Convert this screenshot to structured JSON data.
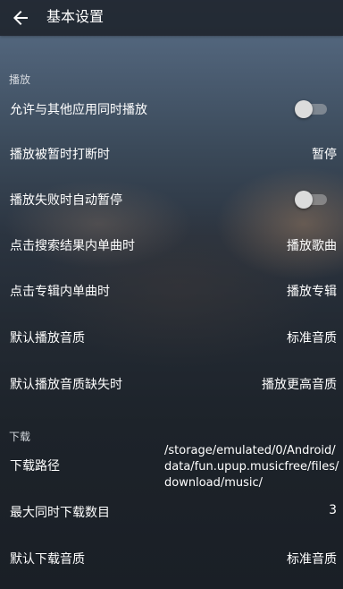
{
  "header": {
    "title": "基本设置"
  },
  "sections": {
    "playback": "播放",
    "download": "下载"
  },
  "playback": {
    "allow_other_apps": {
      "label": "允许与其他应用同时播放",
      "enabled": false
    },
    "on_interrupt": {
      "label": "播放被暂时打断时",
      "value": "暂停"
    },
    "auto_pause_on_fail": {
      "label": "播放失败时自动暂停",
      "enabled": false
    },
    "search_result_click": {
      "label": "点击搜索结果内单曲时",
      "value": "播放歌曲"
    },
    "album_click": {
      "label": "点击专辑内单曲时",
      "value": "播放专辑"
    },
    "default_quality": {
      "label": "默认播放音质",
      "value": "标准音质"
    },
    "quality_missing": {
      "label": "默认播放音质缺失时",
      "value": "播放更高音质"
    }
  },
  "download": {
    "path": {
      "label": "下载路径",
      "value_lines": [
        "/storage/emulated/0/Android/",
        "data/fun.upup.musicfree/files/",
        "download/music/"
      ]
    },
    "max_concurrent": {
      "label": "最大同时下载数目",
      "value": "3"
    },
    "default_quality": {
      "label": "默认下载音质",
      "value": "标准音质"
    }
  },
  "icons": {
    "back": "arrow-left-icon"
  }
}
